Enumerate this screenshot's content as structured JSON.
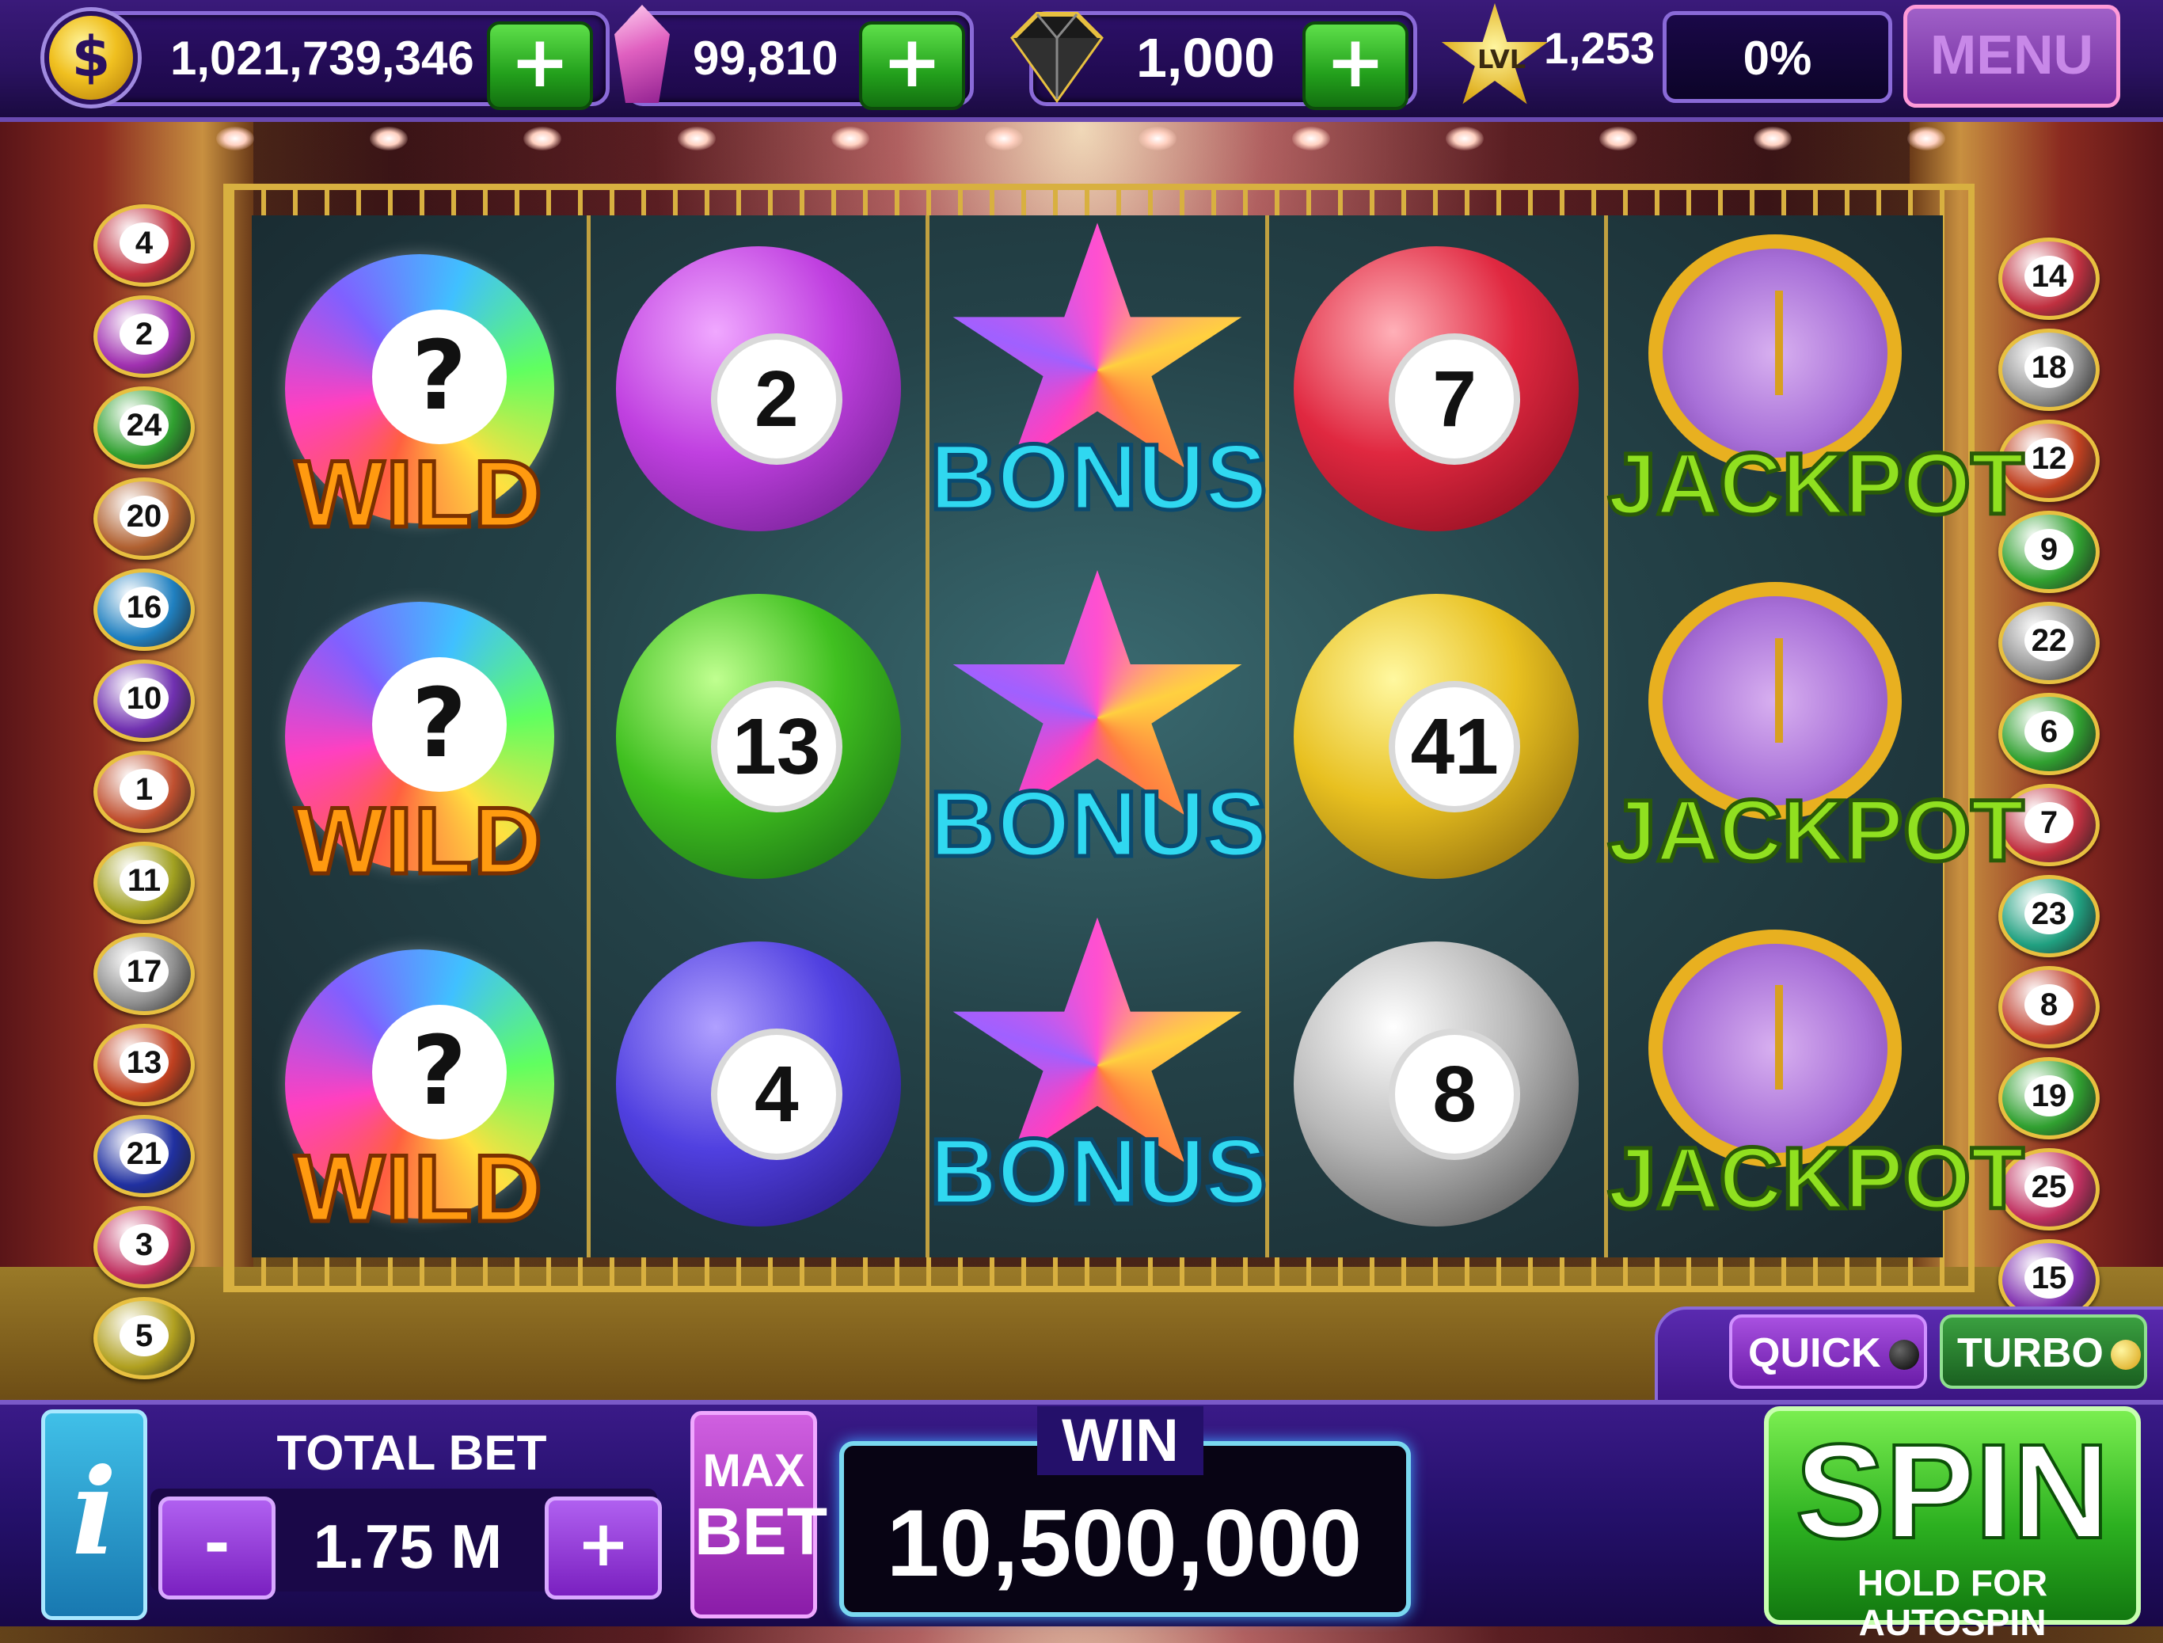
{
  "topbar": {
    "coins": "1,021,739,346",
    "gems": "99,810",
    "diamonds": "1,000",
    "level_prefix": "LVL",
    "level": "1,253",
    "xp_percent": "0%",
    "xp_fraction": 0,
    "menu_label": "MENU",
    "coin_symbol": "$",
    "plus_symbol": "+"
  },
  "left_balls": [
    {
      "n": "4",
      "color": "#c03040"
    },
    {
      "n": "2",
      "color": "#a030b0"
    },
    {
      "n": "24",
      "color": "#30a030"
    },
    {
      "n": "20",
      "color": "#b06030"
    },
    {
      "n": "16",
      "color": "#2080c0"
    },
    {
      "n": "10",
      "color": "#7030b0"
    },
    {
      "n": "1",
      "color": "#c05030"
    },
    {
      "n": "11",
      "color": "#a0a020"
    },
    {
      "n": "17",
      "color": "#909090"
    },
    {
      "n": "13",
      "color": "#c04020"
    },
    {
      "n": "21",
      "color": "#2030a0"
    },
    {
      "n": "3",
      "color": "#c03060"
    },
    {
      "n": "5",
      "color": "#b0a020"
    }
  ],
  "right_balls": [
    {
      "n": "14",
      "color": "#c03040"
    },
    {
      "n": "18",
      "color": "#909090"
    },
    {
      "n": "12",
      "color": "#c04020"
    },
    {
      "n": "9",
      "color": "#30a030"
    },
    {
      "n": "22",
      "color": "#909090"
    },
    {
      "n": "6",
      "color": "#30a030"
    },
    {
      "n": "7",
      "color": "#c03040"
    },
    {
      "n": "23",
      "color": "#20a080"
    },
    {
      "n": "8",
      "color": "#c04030"
    },
    {
      "n": "19",
      "color": "#30a030"
    },
    {
      "n": "25",
      "color": "#c03060"
    },
    {
      "n": "15",
      "color": "#8030b0"
    }
  ],
  "reels": {
    "wild_label": "WILD",
    "wild_symbol": "?",
    "bonus_label": "BONUS",
    "jackpot_label": "JACKPOT",
    "reel2": [
      "2",
      "13",
      "4"
    ],
    "reel4": [
      "7",
      "41",
      "8"
    ]
  },
  "speed": {
    "quick_label": "QUICK",
    "turbo_label": "TURBO"
  },
  "bottombar": {
    "info_label": "i",
    "total_bet_label": "TOTAL BET",
    "minus_label": "-",
    "total_bet_value": "1.75 M",
    "plus_label": "+",
    "max_label": "MAX",
    "bet_label": "BET",
    "win_label": "WIN",
    "win_value": "10,500,000",
    "spin_label": "SPIN",
    "spin_sub_label": "HOLD FOR AUTOSPIN"
  },
  "colors": {
    "accent": "#2cb020",
    "frame_gold": "#d8b040"
  }
}
